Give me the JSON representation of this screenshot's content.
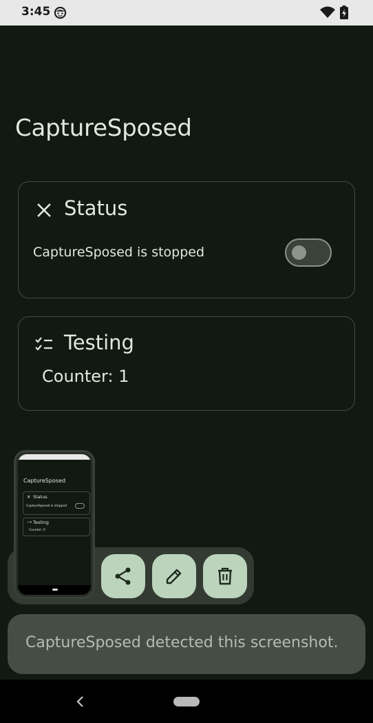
{
  "status_bar": {
    "time": "3:45",
    "icons": [
      "smiley-notification-icon",
      "wifi-icon",
      "battery-charging-icon"
    ]
  },
  "app": {
    "title": "CaptureSposed"
  },
  "status_card": {
    "icon": "close-x-icon",
    "title": "Status",
    "message": "CaptureSposed is stopped",
    "toggle_on": false
  },
  "testing_card": {
    "icon": "checklist-icon",
    "title": "Testing",
    "counter_text": "Counter: 1"
  },
  "screenshot_preview": {
    "app_title": "CaptureSposed",
    "status_title": "Status",
    "status_message": "CaptureSposed is stopped",
    "testing_title": "Testing",
    "counter_text": "Counter: 0",
    "actions": [
      {
        "name": "share",
        "icon": "share-icon"
      },
      {
        "name": "edit",
        "icon": "pencil-icon"
      },
      {
        "name": "delete",
        "icon": "trash-icon"
      }
    ]
  },
  "toast": {
    "message": "CaptureSposed detected this screenshot."
  },
  "navigation": {
    "back_icon": "back-chevron-icon",
    "home_icon": "home-pill-icon"
  },
  "colors": {
    "background": "#121912",
    "card_border": "#434c43",
    "action_button": "#bcd4bc",
    "toast_background": "#454d45"
  }
}
